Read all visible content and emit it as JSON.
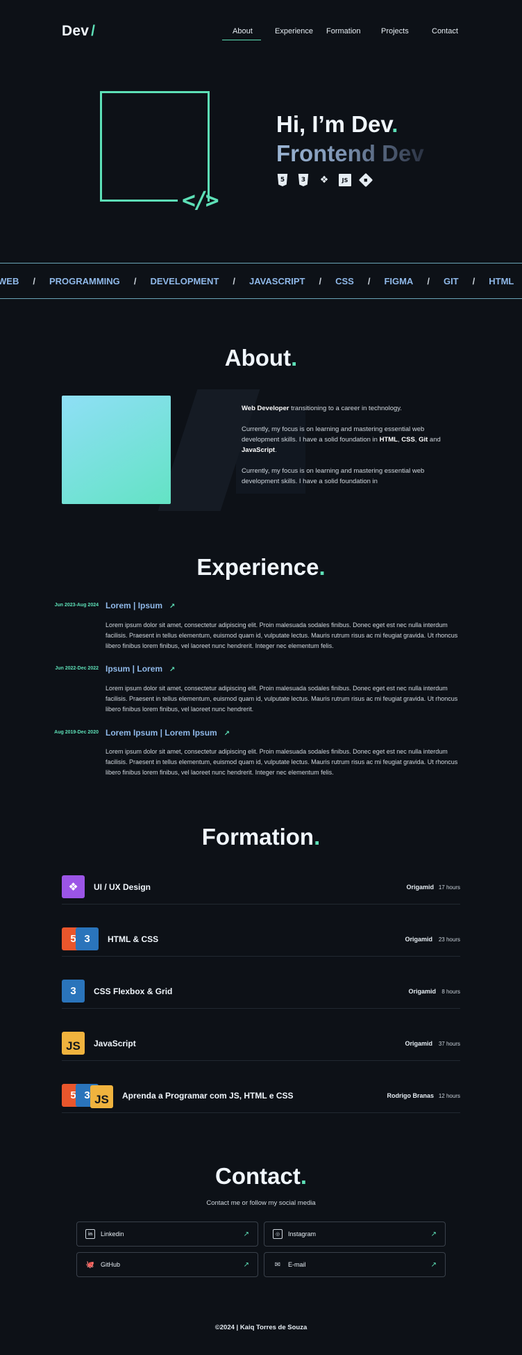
{
  "header": {
    "logo_text": "Dev",
    "logo_slash": "/",
    "nav": [
      {
        "label": "About"
      },
      {
        "label": "Experience"
      },
      {
        "label": "Formation"
      },
      {
        "label": "Projects"
      },
      {
        "label": "Contact"
      }
    ]
  },
  "hero": {
    "code_glyph": "</>",
    "title": "Hi, I’m Dev",
    "title_dot": ".",
    "subtitle": "Frontend Dev",
    "tech_icons": [
      "html5-icon",
      "css3-icon",
      "figma-icon",
      "javascript-icon",
      "git-icon"
    ],
    "tech_glyphs": {
      "html": "5",
      "css": "3",
      "figma": "❖",
      "js": "JS",
      "git": "◆"
    }
  },
  "band": {
    "items": [
      "WEB",
      "PROGRAMMING",
      "DEVELOPMENT",
      "JAVASCRIPT",
      "CSS",
      "FIGMA",
      "GIT",
      "HTML"
    ],
    "separator": "/"
  },
  "about": {
    "title": "About",
    "dot": ".",
    "p1_bold": "Web Developer",
    "p1_rest": " transitioning to a career in technology.",
    "p2_a": "Currently, my focus is on learning and mastering essential web development skills. I have a solid foundation in ",
    "p2_html": "HTML",
    "p2_sep1": ", ",
    "p2_css": "CSS",
    "p2_sep2": ", ",
    "p2_git": "Git",
    "p2_and": " and ",
    "p2_js": "JavaScript",
    "p2_end": ".",
    "p3": "Currently, my focus is on learning and mastering essential web development skills. I have a solid foundation in"
  },
  "experience": {
    "title": "Experience",
    "dot": ".",
    "items": [
      {
        "date": "Jun 2023-Aug 2024",
        "title": "Lorem | Ipsum",
        "body": "Lorem ipsum dolor sit amet, consectetur adipiscing elit. Proin malesuada sodales finibus. Donec eget est nec nulla interdum facilisis. Praesent  in tellus elementum, euismod quam id, vulputate lectus. Mauris rutrum  risus ac mi feugiat gravida. Ut rhoncus libero finibus lorem finibus,  vel laoreet nunc hendrerit. Integer nec elementum felis."
      },
      {
        "date": "Jun 2022-Dec 2022",
        "title": "Ipsum | Lorem",
        "body": "Lorem ipsum dolor sit amet, consectetur adipiscing elit. Proin malesuada sodales finibus. Donec eget est nec nulla interdum facilisis. Praesent  in tellus elementum, euismod quam id, vulputate lectus. Mauris rutrum  risus ac mi feugiat gravida. Ut rhoncus libero finibus lorem finibus,  vel laoreet nunc hendrerit."
      },
      {
        "date": "Aug 2019-Dec 2020",
        "title": "Lorem Ipsum | Lorem Ipsum",
        "body": "Lorem ipsum dolor sit amet, consectetur adipiscing elit. Proin malesuada sodales finibus. Donec eget est nec nulla interdum facilisis. Praesent  in tellus elementum, euismod quam id, vulputate lectus. Mauris rutrum  risus ac mi feugiat gravida. Ut rhoncus libero finibus lorem finibus,  vel laoreet nunc hendrerit. Integer nec elementum felis."
      }
    ],
    "arrow": "↗"
  },
  "formation": {
    "title": "Formation",
    "dot": ".",
    "logo_glyphs": {
      "figma": "❖",
      "html": "5",
      "css": "3",
      "js": "JS"
    },
    "items": [
      {
        "name": "UI / UX Design",
        "school": "Origamid",
        "hours": "17 hours"
      },
      {
        "name": "HTML & CSS",
        "school": "Origamid",
        "hours": "23 hours"
      },
      {
        "name": "CSS Flexbox & Grid",
        "school": "Origamid",
        "hours": "8 hours"
      },
      {
        "name": "JavaScript",
        "school": "Origamid",
        "hours": "37 hours"
      },
      {
        "name": "Aprenda a Programar com JS, HTML e CSS",
        "school": "Rodrigo Branas",
        "hours": "12 hours"
      }
    ]
  },
  "contact": {
    "title": "Contact",
    "dot": ".",
    "subtitle": "Contact me or follow my social media",
    "links": [
      {
        "label": "Linkedin",
        "icon_glyph": "in"
      },
      {
        "label": "Instagram",
        "icon_glyph": "◎"
      },
      {
        "label": "GitHub",
        "icon_glyph": "🐙"
      },
      {
        "label": "E-mail",
        "icon_glyph": "✉"
      }
    ],
    "arrow": "↗"
  },
  "footer": {
    "text": "©2024 | Kaiq Torres de Souza"
  },
  "colors": {
    "background": "#0d1117",
    "accent": "#5de0b7",
    "link_blue": "#8fb8e8"
  }
}
